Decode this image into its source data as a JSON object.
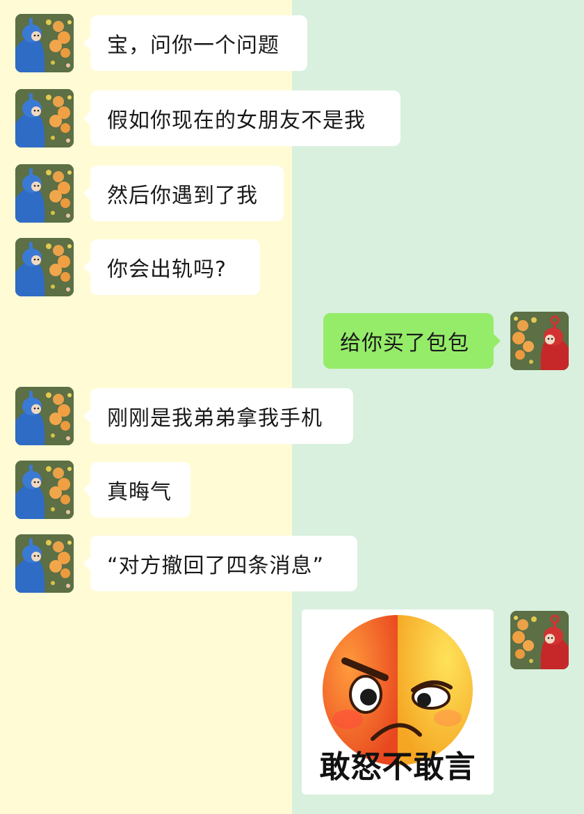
{
  "messages": [
    {
      "side": "in",
      "text": "宝，问你一个问题"
    },
    {
      "side": "in",
      "text": "假如你现在的女朋友不是我"
    },
    {
      "side": "in",
      "text": "然后你遇到了我"
    },
    {
      "side": "in",
      "text": "你会出轨吗?"
    },
    {
      "side": "out",
      "text": "给你买了包包"
    },
    {
      "side": "in",
      "text": "刚刚是我弟弟拿我手机"
    },
    {
      "side": "in",
      "text": "真晦气"
    },
    {
      "side": "in",
      "text": "“对方撤回了四条消息”"
    }
  ],
  "sticker": {
    "caption": "敢怒不敢言",
    "icon": "angry-sad-face-emoji"
  },
  "avatars": {
    "incoming": "blue-teletubby-avatar",
    "outgoing": "red-teletubby-avatar"
  },
  "colors": {
    "left_bg": "#fffbd5",
    "right_bg": "#d9f0de",
    "incoming_bubble": "#ffffff",
    "outgoing_bubble": "#95ec69"
  }
}
